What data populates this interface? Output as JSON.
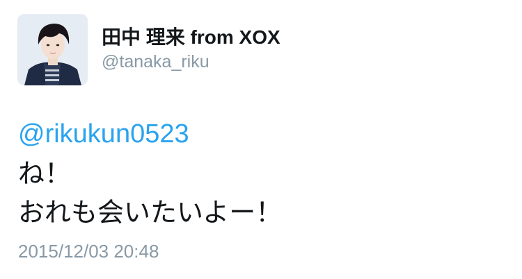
{
  "tweet": {
    "display_name": "田中 理来 from XOX",
    "handle": "@tanaka_riku",
    "mention": "@rikukun0523",
    "lines": [
      "ね！",
      "おれも会いたいよー！"
    ],
    "timestamp": "2015/12/03 20:48"
  },
  "colors": {
    "mention": "#2aa3ef",
    "text": "#14171a",
    "muted": "#8899a6"
  },
  "icons": {
    "avatar": "profile-photo"
  }
}
